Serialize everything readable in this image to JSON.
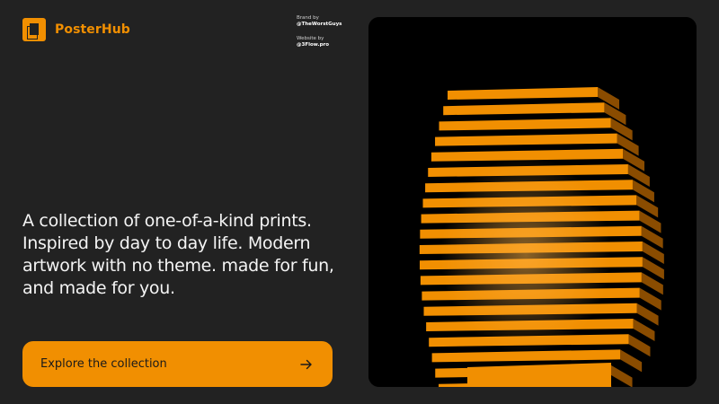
{
  "brand": {
    "name": "PosterHub",
    "logo_icon": "poster-logo-icon",
    "accent": "#f18f01"
  },
  "credits": {
    "brand_label": "Brand by",
    "brand_value": "@TheWorstGuys",
    "website_label": "Website by",
    "website_value": "@3Flow.pro"
  },
  "hero": {
    "tagline": "A collection of one-of-a-kind prints. Inspired by day to day life. Modern artwork with no theme. made for fun, and made for you."
  },
  "cta": {
    "label": "Explore the collection",
    "icon": "arrow-right-icon"
  },
  "poster": {
    "subject": "orange tower artwork",
    "colors": {
      "background": "#000000",
      "accent": "#f18f01"
    }
  }
}
